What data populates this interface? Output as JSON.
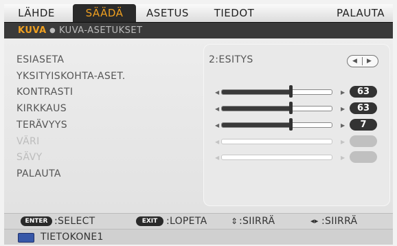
{
  "tabs": [
    "LÄHDE",
    "SÄÄDÄ",
    "ASETUS",
    "TIEDOT",
    "PALAUTA"
  ],
  "active_tab": "SÄÄDÄ",
  "subtabs": {
    "active": "KUVA",
    "inactive": "KUVA-ASETUKSET"
  },
  "rows": {
    "preset": {
      "label": "ESIASETA",
      "value": "2:ESITYS"
    },
    "detail": {
      "label": "YKSITYISKOHTA-ASET."
    },
    "contrast": {
      "label": "KONTRASTI",
      "value": "63",
      "level_pct": 63
    },
    "brightness": {
      "label": "KIRKKAUS",
      "value": "63",
      "level_pct": 63
    },
    "sharpness": {
      "label": "TERÄVYYS",
      "value": "7",
      "level_pct": 63
    },
    "color": {
      "label": "VÄRI",
      "value": "",
      "disabled": true
    },
    "tint": {
      "label": "SÄVY",
      "value": "",
      "disabled": true
    },
    "reset": {
      "label": "PALAUTA"
    }
  },
  "footer": {
    "enter_key": "ENTER",
    "enter_text": ":SELECT",
    "exit_key": "EXIT",
    "exit_text": ":LOPETA",
    "move_ud_text": ":SIIRRÄ",
    "move_lr_text": ":SIIRRÄ"
  },
  "status": {
    "source": "TIETOKONE1"
  },
  "colors": {
    "accent": "#f0a020",
    "dark": "#333333"
  }
}
